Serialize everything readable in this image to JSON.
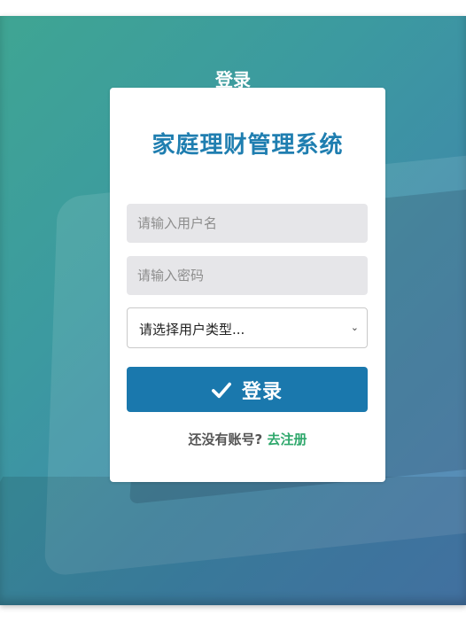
{
  "page": {
    "heading": "登录"
  },
  "card": {
    "title": "家庭理财管理系统",
    "username": {
      "value": "",
      "placeholder": "请输入用户名"
    },
    "password": {
      "value": "",
      "placeholder": "请输入密码"
    },
    "user_type": {
      "selected": "请选择用户类型..."
    },
    "login_button": {
      "label": "登录",
      "icon": "check-icon"
    },
    "register": {
      "prompt": "还没有账号?",
      "link": "去注册"
    }
  },
  "colors": {
    "primary": "#1a78ad",
    "title": "#1f7eb0",
    "link": "#2fa86c",
    "input_bg": "#e6e6e9"
  }
}
